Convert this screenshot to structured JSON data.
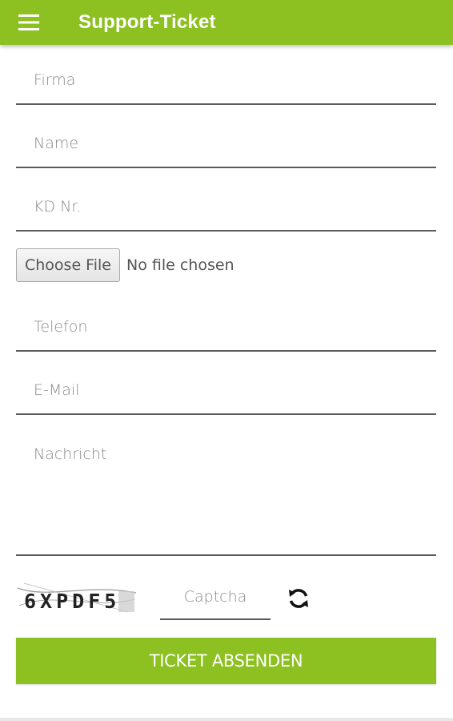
{
  "appbar": {
    "title": "Support-Ticket",
    "menu_icon": "hamburger-menu-icon",
    "color": "#8dc021"
  },
  "form": {
    "firma_placeholder": "Firma",
    "name_placeholder": "Name",
    "kd_placeholder": "KD Nr.",
    "file_button_label": "Choose File",
    "file_status": "No file chosen",
    "telefon_placeholder": "Telefon",
    "email_placeholder": "E-Mail",
    "nachricht_placeholder": "Nachricht",
    "captcha_text": "6XPDF5",
    "captcha_placeholder": "Captcha",
    "refresh_icon": "refresh-icon",
    "submit_label": "TICKET ABSENDEN"
  }
}
